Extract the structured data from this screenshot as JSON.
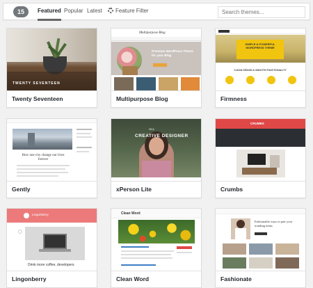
{
  "filter_bar": {
    "theme_count": "15",
    "tabs": [
      {
        "label": "Featured",
        "current": true
      },
      {
        "label": "Popular",
        "current": false
      },
      {
        "label": "Latest",
        "current": false
      }
    ],
    "feature_filter_label": "Feature Filter",
    "search_placeholder": "Search themes..."
  },
  "themes": [
    {
      "name": "Twenty Seventeen",
      "shot_text": "TWENTY SEVENTEEN"
    },
    {
      "name": "Multipurpose Blog",
      "shot_text": "Multipurpose Blog",
      "shot_banner": "Premium WordPress Theme for your Blog"
    },
    {
      "name": "Firmness",
      "shot_text": "SIMPLE & POWERFUL WORDPRESS THEME",
      "shot_sub": "CLEAN DESIGN & SMOOTH FUNCTIONALITY"
    },
    {
      "name": "Gently",
      "shot_text": "How one city change our lives forever"
    },
    {
      "name": "xPerson Lite",
      "shot_text": "CREATIVE DESIGNER",
      "shot_hello": "I'M A"
    },
    {
      "name": "Crumbs",
      "shot_text": "CRUMBS"
    },
    {
      "name": "Lingonberry",
      "shot_text": "Lingonberry",
      "shot_sub": "Drink more coffee, developers"
    },
    {
      "name": "Clean Word",
      "shot_text": "Clean Word"
    },
    {
      "name": "Fashionate",
      "shot_text": "Fashionable ways to pair your trending items"
    }
  ],
  "colors": {
    "accent_red": "#e04848",
    "firmness_yellow": "#f1c40f",
    "lingonberry_pink": "#ec7a7a"
  }
}
